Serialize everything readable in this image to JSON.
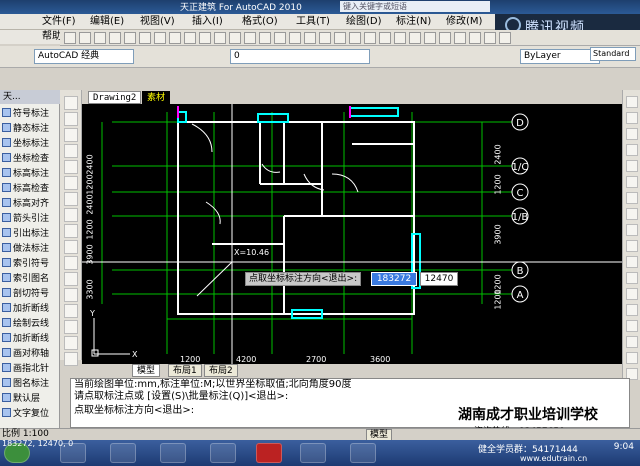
{
  "title": {
    "app": "天正建筑 For AutoCAD 2010",
    "search_placeholder": "键入关键字或短语"
  },
  "menus": [
    "文件(F)",
    "编辑(E)",
    "视图(V)",
    "插入(I)",
    "格式(O)",
    "工具(T)",
    "绘图(D)",
    "标注(N)",
    "修改(M)",
    "参"
  ],
  "menu_help": "帮助(H)",
  "brand": "腾讯视频",
  "standard_box": "Standard",
  "workspace_combo": "AutoCAD 经典",
  "layer_combo": "0",
  "linetype_combo": "ByLayer",
  "panel_title": "天...",
  "left_panel_items": [
    "符号标注",
    "静态标注",
    "坐标标注",
    "坐标检查",
    "标高标注",
    "标高检查",
    "标高对齐",
    "箭头引注",
    "引出标注",
    "做法标注",
    "索引符号",
    "索引图名",
    "剖切符号",
    "加折断线",
    "绘制云线",
    "加折断线",
    "画对称轴",
    "画指北针",
    "图名标注",
    "默认层",
    "文字复位"
  ],
  "tabs": {
    "drawing": "Drawing2",
    "material": "素材"
  },
  "layout_tabs": [
    "模型",
    "布局1",
    "布局2"
  ],
  "axis_labels_right": [
    "D",
    "1/C",
    "C",
    "1/B",
    "B",
    "A"
  ],
  "dims_left": [
    "2400",
    "1200",
    "2400",
    "1200",
    "3900",
    "3300"
  ],
  "dims_right": [
    "2400",
    "1200",
    "3900",
    "1200",
    "1200"
  ],
  "dims_bottom": [
    "1200",
    "4200",
    "2700",
    "3600"
  ],
  "cursor_readout": "X=10.46",
  "prompt_tip": "点取坐标标注方向<退出>:",
  "input_x": "183272",
  "input_y": "12470",
  "command_lines": [
    "当前绘图单位:mm,标注单位:M;以世界坐标取值;北向角度90度",
    "请点取标注点或 [设置(S)\\批量标注(Q)]<退出>:",
    "点取坐标标注方向<退出>:"
  ],
  "watermark": {
    "school": "湖南成才职业培训学校",
    "phone1": "咨询热线：92457650",
    "phone2": "健全学员群：54171444",
    "site": "www.edutrain.cn"
  },
  "status": {
    "scale": "比例 1:100",
    "model": "模型"
  },
  "coords_readout": "183272, 12470, 0",
  "clock": {
    "time": "9:04",
    "date": "2012/5/22"
  }
}
